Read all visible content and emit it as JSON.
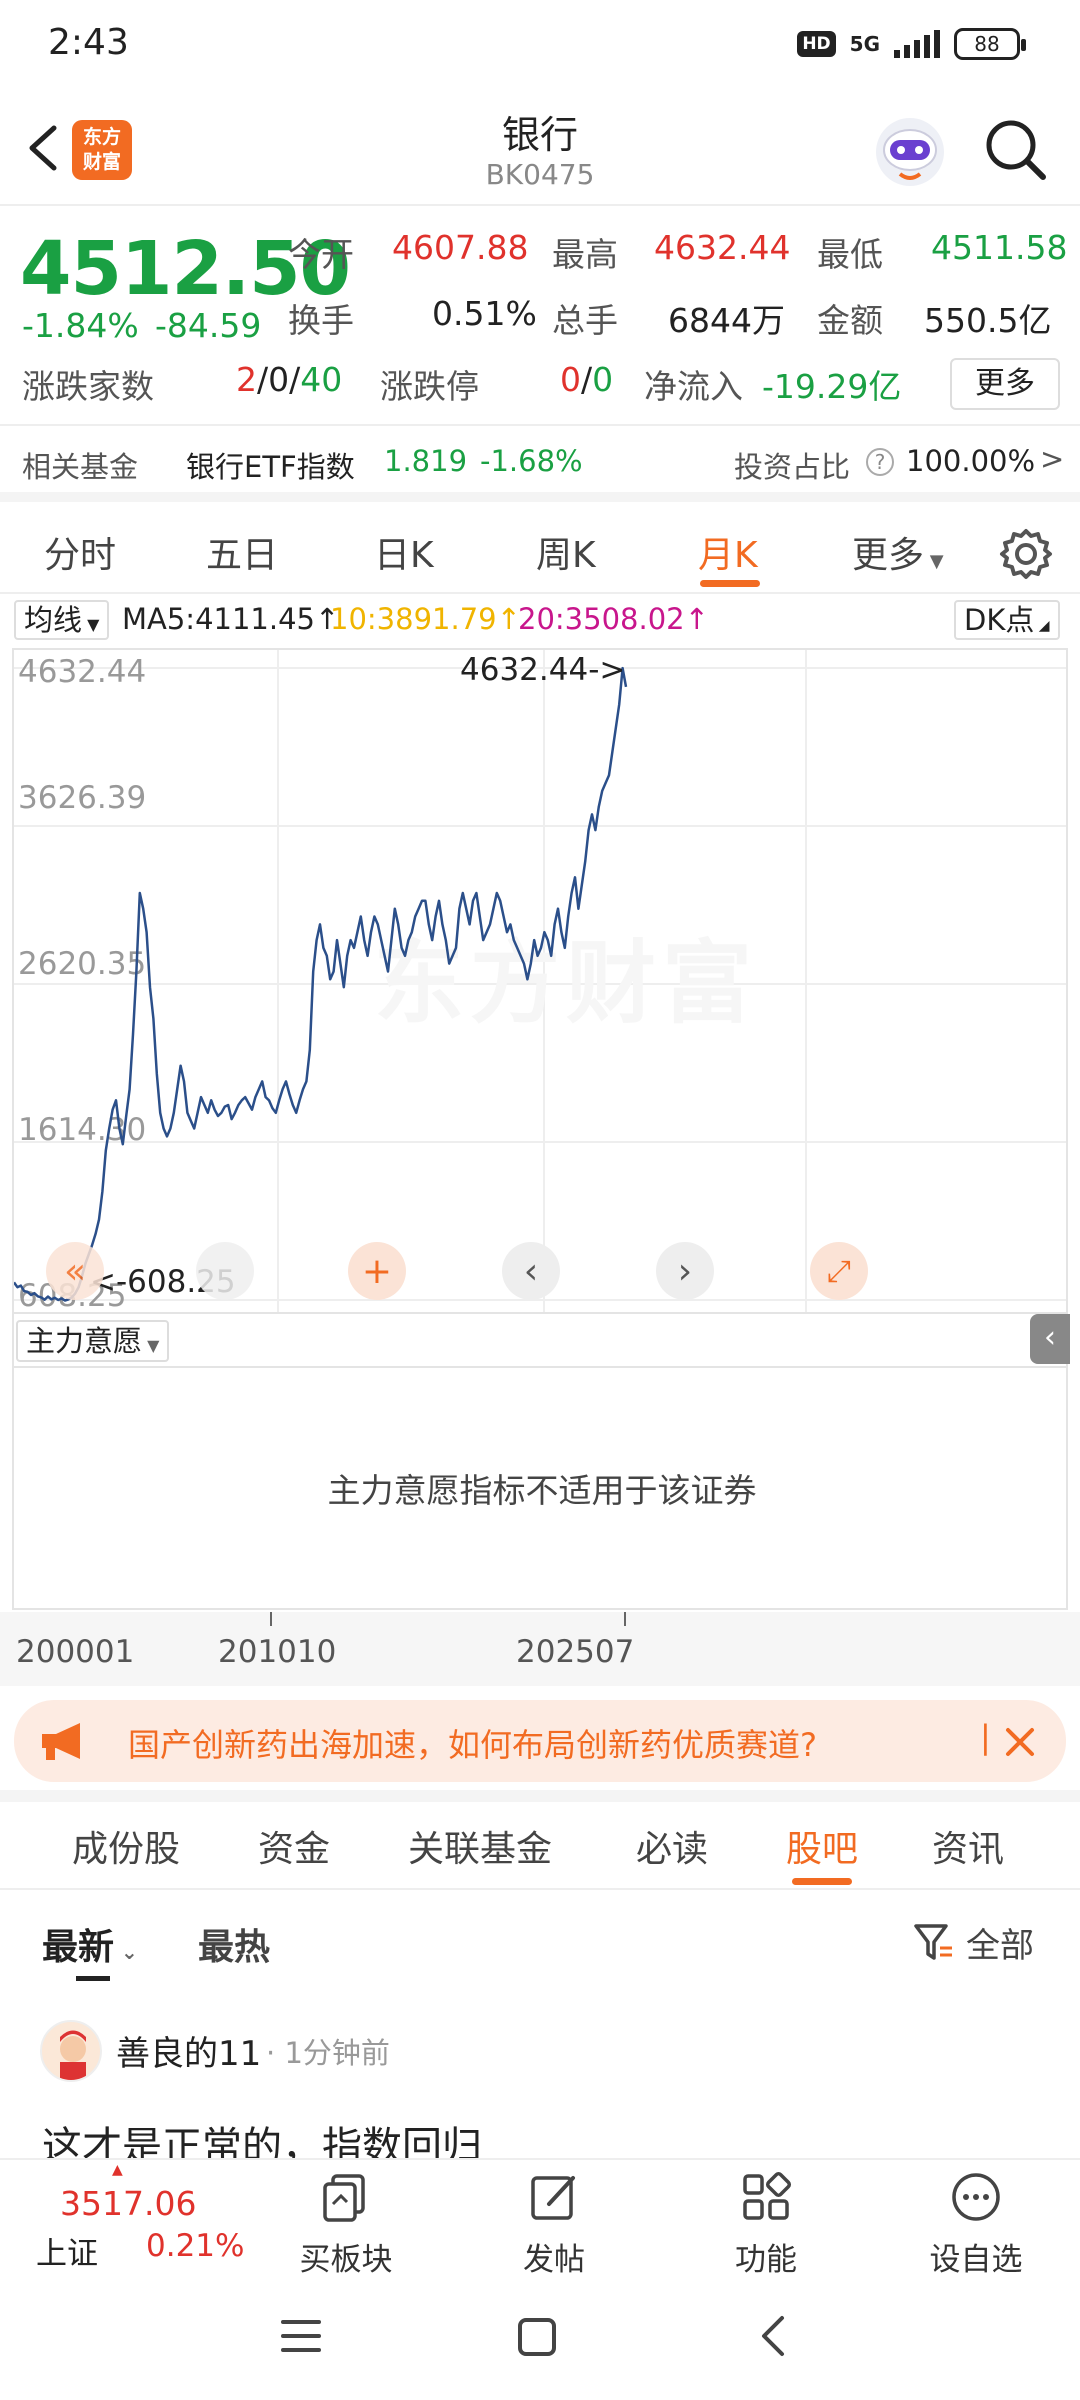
{
  "status_bar": {
    "time": "2:43",
    "hd": "HD",
    "network": "5G",
    "battery": "88"
  },
  "header": {
    "logo_text": "东方\n财富",
    "title": "银行",
    "code": "BK0475"
  },
  "quote": {
    "price": "4512.50",
    "change_pct": "-1.84%",
    "change": "-84.59",
    "today_open_label": "今开",
    "today_open": "4607.88",
    "high_label": "最高",
    "high": "4632.44",
    "low_label": "最低",
    "low": "4511.58",
    "turnover_label": "换手",
    "turnover": "0.51%",
    "volume_label": "总手",
    "volume": "6844万",
    "amount_label": "金额",
    "amount": "550.5亿",
    "updown_label": "涨跌家数",
    "up": "2",
    "flat": "0",
    "down": "40",
    "limit_label": "涨跌停",
    "limit_up": "0",
    "limit_down": "0",
    "inflow_label": "净流入",
    "inflow": "-19.29亿",
    "more": "更多",
    "slash": "/"
  },
  "fund": {
    "label": "相关基金",
    "name": "银行ETF指数",
    "value": "1.819",
    "change": "-1.68%",
    "ratio_label": "投资占比",
    "ratio": "100.00%",
    "help": "?",
    "arrow": ">"
  },
  "tabs": [
    "分时",
    "五日",
    "日K",
    "周K",
    "月K",
    "更多"
  ],
  "active_tab": "月K",
  "ma": {
    "select": "均线",
    "ma5": "MA5:4111.45",
    "ma10": "10:3891.79",
    "ma20": "20:3508.02",
    "dk": "DK点",
    "arrow": "↑",
    "colors": {
      "ma5": "#222222",
      "ma10": "#f0b400",
      "ma20": "#c8168c"
    }
  },
  "chart_data": {
    "type": "line",
    "series": [
      {
        "values": [
          720,
          690,
          700,
          665,
          660,
          640,
          652,
          632,
          625,
          610,
          630,
          612,
          622,
          608,
          618,
          605,
          612,
          625,
          650,
          690,
          760,
          840,
          900,
          960,
          1030,
          1120,
          1300,
          1560,
          1700,
          1820,
          1880,
          1700,
          1600,
          1780,
          1950,
          2300,
          2700,
          3200,
          3100,
          2950,
          2600,
          2400,
          2050,
          1800,
          1700,
          1650,
          1700,
          1800,
          1950,
          2100,
          2000,
          1800,
          1750,
          1700,
          1800,
          1900,
          1850,
          1800,
          1880,
          1820,
          1780,
          1800,
          1840,
          1850,
          1760,
          1800,
          1850,
          1880,
          1900,
          1860,
          1820,
          1900,
          1950,
          2000,
          1900,
          1880,
          1830,
          1800,
          1880,
          1950,
          2000,
          1920,
          1850,
          1800,
          1880,
          1950,
          2000,
          2200,
          2700,
          2900,
          3000,
          2850,
          2800,
          2650,
          2700,
          2900,
          2750,
          2600,
          2800,
          2900,
          2850,
          2950,
          3050,
          2900,
          2800,
          2950,
          3050,
          3000,
          2900,
          2800,
          2700,
          2900,
          3100,
          3000,
          2850,
          2800,
          2900,
          2950,
          3050,
          3100,
          3150,
          3150,
          3000,
          2900,
          3050,
          3150,
          3000,
          2900,
          2750,
          2800,
          2850,
          3100,
          3200,
          3100,
          3000,
          3150,
          3200,
          3050,
          2900,
          2950,
          3000,
          3100,
          3200,
          3150,
          3050,
          2950,
          3000,
          2900,
          2850,
          2800,
          2750,
          2650,
          2750,
          2900,
          2800,
          2850,
          2950,
          2900,
          2800,
          3000,
          3100,
          2950,
          2850,
          3050,
          3200,
          3300,
          3100,
          3250,
          3400,
          3600,
          3700,
          3600,
          3750,
          3850,
          3900,
          3950,
          4100,
          4250,
          4400,
          4632,
          4512
        ]
      }
    ],
    "y_ticks": [
      "4632.44",
      "3626.39",
      "2620.35",
      "1614.30",
      "608.25"
    ],
    "max_label": "4632.44->",
    "min_label": "<-608.25",
    "ylim": [
      608.25,
      4632.44
    ],
    "x_ticks": [
      "200001",
      "201010",
      "202507"
    ]
  },
  "sub_panel": {
    "select": "主力意愿",
    "message": "主力意愿指标不适用于该证券"
  },
  "banner": {
    "text": "国产创新药出海加速，如何布局创新药优质赛道?",
    "divider": "|"
  },
  "info_tabs": [
    "成份股",
    "资金",
    "关联基金",
    "必读",
    "股吧",
    "资讯"
  ],
  "active_info_tab": "股吧",
  "sort": {
    "latest": "最新",
    "hot": "最热",
    "filter": "全部"
  },
  "post": {
    "user": "善良的11",
    "dot": "·",
    "time": "1分钟前",
    "text": "这才是正常的，指数回归"
  },
  "bottom_bar": {
    "index_value": "3517.06",
    "index_name": "上证",
    "index_change": "0.21%",
    "items": [
      "买板块",
      "发帖",
      "功能",
      "设自选"
    ]
  }
}
